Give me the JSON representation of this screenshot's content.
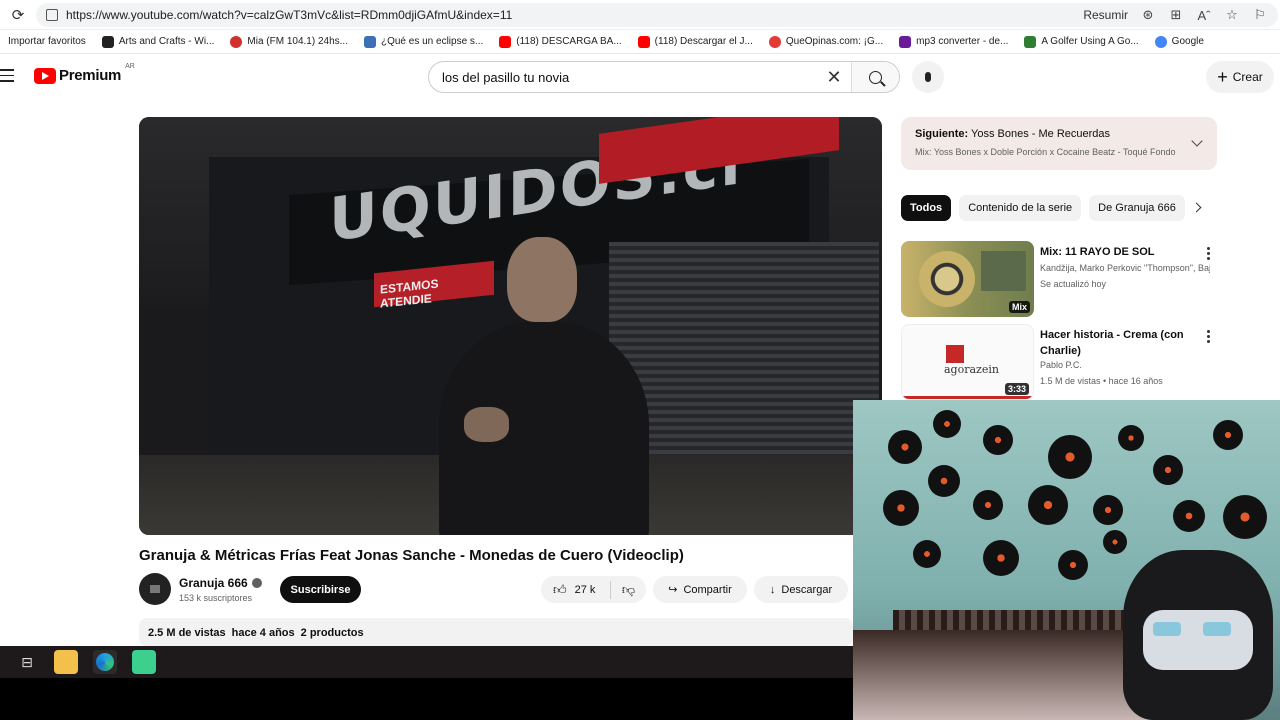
{
  "browser": {
    "url": "https://www.youtube.com/watch?v=calzGwT3mVc&list=RDmm0djiGAfmU&index=11",
    "resume_label": "Resumir",
    "bookmarks": [
      {
        "label": "Importar favoritos",
        "color": ""
      },
      {
        "label": "Arts and Crafts - Wi...",
        "color": "#222222"
      },
      {
        "label": "Mia (FM 104.1) 24hs...",
        "color": "#d32f2f"
      },
      {
        "label": "¿Qué es un eclipse s...",
        "color": "#3d6fb6"
      },
      {
        "label": "(118) DESCARGA BA...",
        "color": "#ff0000"
      },
      {
        "label": "(118) Descargar el J...",
        "color": "#ff0000"
      },
      {
        "label": "QueOpinas.com: ¡G...",
        "color": "#e53935"
      },
      {
        "label": "mp3 converter - de...",
        "color": "#6a1b9a"
      },
      {
        "label": "A Golfer Using A Go...",
        "color": "#2e7d32"
      },
      {
        "label": "Google",
        "color": "#4285f4"
      }
    ]
  },
  "header": {
    "logo_text": "Premium",
    "country": "AR",
    "search_value": "los del pasillo  tu novia",
    "create_label": "Crear"
  },
  "video": {
    "sign_text": "UQUIDOS.cl",
    "red_sign_text": "ESTAMOS ATENDIE",
    "title": "Granuja & Métricas Frías Feat Jonas Sanche - Monedas de Cuero (Videoclip)",
    "channel": "Granuja 666",
    "subscribers": "153 k suscriptores",
    "subscribe_label": "Suscribirse",
    "likes": "27 k",
    "share_label": "Compartir",
    "download_label": "Descargar",
    "views": "2.5 M de vistas",
    "age": "hace 4 años",
    "products": "2 productos"
  },
  "sidebar": {
    "up_next_label": "Siguiente:",
    "up_next_title": "Yoss Bones - Me Recuerdas",
    "up_next_sub": "Mix: Yoss Bones x Doble Porción x Cocaine Beatz - Toqué Fondo",
    "chips": [
      "Todos",
      "Contenido de la serie",
      "De Granuja 666"
    ],
    "recs": [
      {
        "title": "Mix: 11  RAYO DE SOL",
        "meta1": "Kandžija, Marko Perkovic \"Thompson\", Bajaga y más",
        "meta2": "Se actualizó hoy",
        "badge": "Mix"
      },
      {
        "title": "Hacer historia - Crema (con Charlie)",
        "meta1": "Pablo P.C.",
        "meta2": "1.5 M de vistas • hace 16 años",
        "badge": "3:33",
        "thumb_text": "agorazein"
      }
    ]
  }
}
